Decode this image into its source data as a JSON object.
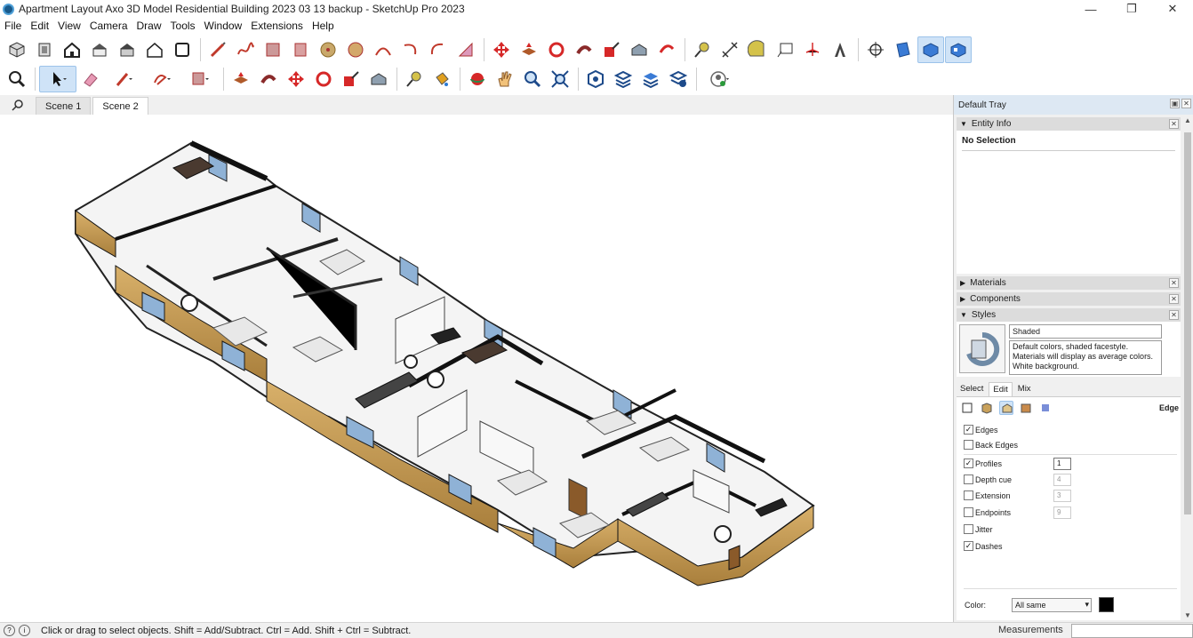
{
  "window": {
    "title": "Apartment Layout Axo 3D Model Residential Building 2023 03 13 backup - SketchUp Pro 2023",
    "minimize": "—",
    "restore": "❐",
    "close": "✕"
  },
  "menu": [
    "File",
    "Edit",
    "View",
    "Camera",
    "Draw",
    "Tools",
    "Window",
    "Extensions",
    "Help"
  ],
  "scenes": {
    "tabs": [
      "Scene 1",
      "Scene 2"
    ],
    "selected_index": 1
  },
  "tray": {
    "title": "Default Tray",
    "entity_info": {
      "label": "Entity Info",
      "selection": "No Selection"
    },
    "materials": {
      "label": "Materials"
    },
    "components": {
      "label": "Components"
    },
    "styles": {
      "label": "Styles",
      "name": "Shaded",
      "description": "Default colors, shaded facestyle. Materials will display as average colors. White background.",
      "tabs": [
        "Select",
        "Edit",
        "Mix"
      ],
      "selected_tab": "Edit",
      "section_label": "Edge",
      "options": [
        {
          "label": "Edges",
          "checked": true
        },
        {
          "label": "Back Edges",
          "checked": false
        },
        {
          "label": "Profiles",
          "checked": true,
          "value": "1"
        },
        {
          "label": "Depth cue",
          "checked": false,
          "value": "4"
        },
        {
          "label": "Extension",
          "checked": false,
          "value": "3"
        },
        {
          "label": "Endpoints",
          "checked": false,
          "value": "9"
        },
        {
          "label": "Jitter",
          "checked": false
        },
        {
          "label": "Dashes",
          "checked": true
        }
      ],
      "color_label": "Color:",
      "color_value": "All same",
      "color_swatch": "#000000"
    }
  },
  "status": {
    "hint": "Click or drag to select objects. Shift = Add/Subtract. Ctrl = Add. Shift + Ctrl = Subtract.",
    "measurements_label": "Measurements",
    "measurements_value": ""
  },
  "colors": {
    "accent": "#cfe3f7",
    "wood": "#c9a15b",
    "wall": "#1a1a1a",
    "glass": "#8fb2d6"
  }
}
